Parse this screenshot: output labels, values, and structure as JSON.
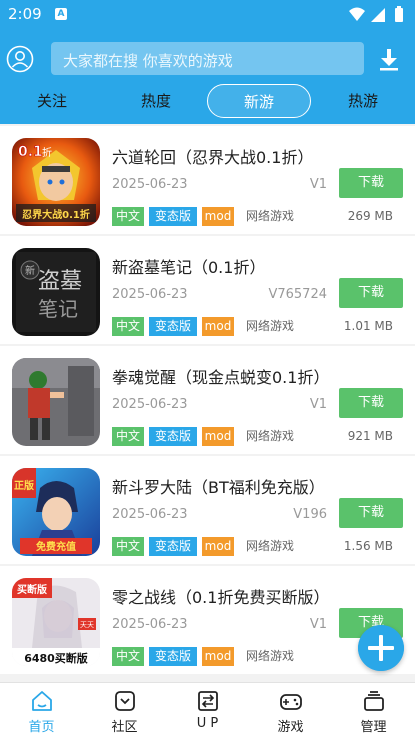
{
  "status": {
    "time": "2:09",
    "badge": "A"
  },
  "search": {
    "placeholder": "大家都在搜 你喜欢的游戏"
  },
  "tabs": [
    {
      "label": "关注"
    },
    {
      "label": "热度"
    },
    {
      "label": "新游",
      "active": true
    },
    {
      "label": "热游"
    }
  ],
  "games": [
    {
      "title": "六道轮回（忍界大战0.1折）",
      "date": "2025-06-23",
      "version": "V1",
      "download": "下载",
      "tags": [
        "中文",
        "变态版",
        "mod"
      ],
      "network": "网络游戏",
      "size": "269 MB"
    },
    {
      "title": "新盗墓笔记（0.1折）",
      "date": "2025-06-23",
      "version": "V765724",
      "download": "下载",
      "tags": [
        "中文",
        "变态版",
        "mod"
      ],
      "network": "网络游戏",
      "size": "1.01 MB"
    },
    {
      "title": "拳魂觉醒（现金点蜕变0.1折）",
      "date": "2025-06-23",
      "version": "V1",
      "download": "下载",
      "tags": [
        "中文",
        "变态版",
        "mod"
      ],
      "network": "网络游戏",
      "size": "921 MB"
    },
    {
      "title": "新斗罗大陆（BT福利免充版）",
      "date": "2025-06-23",
      "version": "V196",
      "download": "下载",
      "tags": [
        "中文",
        "变态版",
        "mod"
      ],
      "network": "网络游戏",
      "size": "1.56 MB"
    },
    {
      "title": "零之战线（0.1折免费买断版）",
      "date": "2025-06-23",
      "version": "V1",
      "download": "下载",
      "tags": [
        "中文",
        "变态版",
        "mod"
      ],
      "network": "网络游戏",
      "size": ""
    }
  ],
  "icon_texts": {
    "g1_big": "0.1",
    "g1_small": "折",
    "g1_bottom": "忍界大战0.1折",
    "g2_main": "盗墓",
    "g2_sub": "笔记",
    "g2_seal": "新",
    "g4_top": "正版",
    "g4_bottom": "免费充值",
    "g5_top": "买断版",
    "g5_bottom": "6480买断版",
    "g5_tag": "天天"
  },
  "bottom_nav": [
    {
      "label": "首页",
      "icon": "home-icon",
      "active": true
    },
    {
      "label": "社区",
      "icon": "community-icon"
    },
    {
      "label": "U P",
      "icon": "up-icon"
    },
    {
      "label": "游戏",
      "icon": "gamepad-icon"
    },
    {
      "label": "管理",
      "icon": "manage-icon"
    }
  ],
  "colors": {
    "primary": "#2aa7e8",
    "download": "#5ac26b",
    "tag_green": "#5ac26b",
    "tag_blue": "#2aa7e8",
    "tag_orange": "#f39a2b"
  }
}
